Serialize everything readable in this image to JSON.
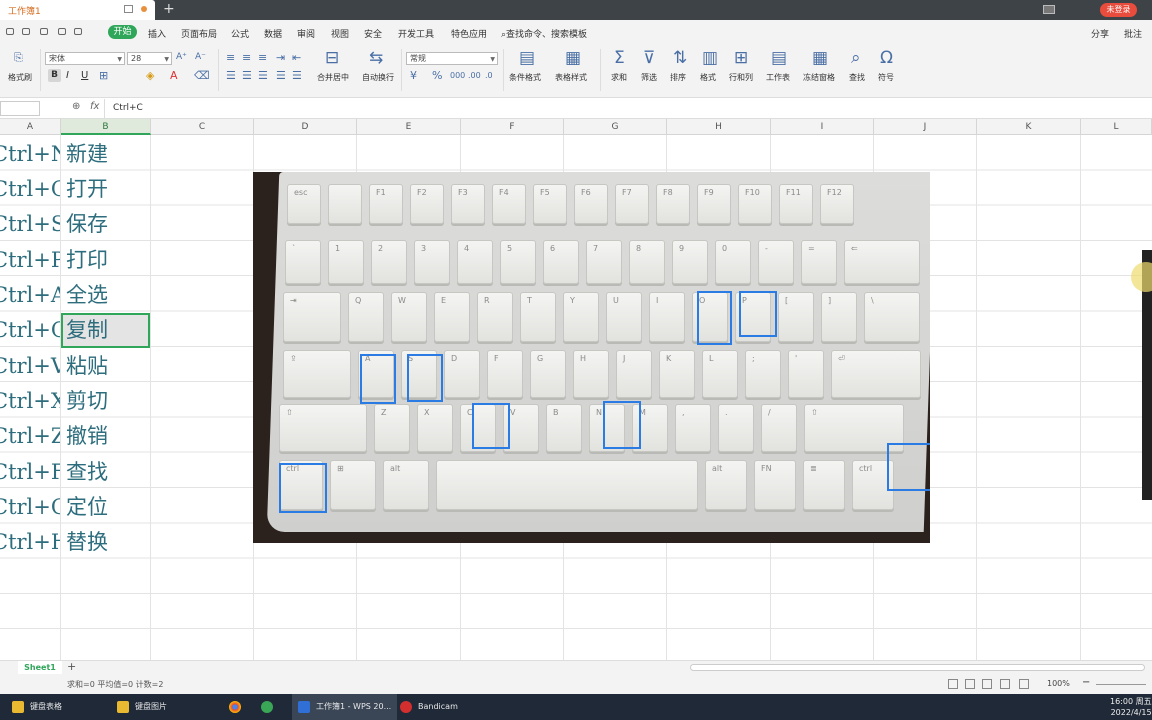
{
  "window": {
    "doc_tab_title": "工作簿1",
    "login_label": "未登录"
  },
  "menu": {
    "items": [
      "开始",
      "插入",
      "页面布局",
      "公式",
      "数据",
      "审阅",
      "视图",
      "安全",
      "开发工具",
      "特色应用"
    ],
    "search_placeholder": "查找命令、搜索模板",
    "share_label": "分享",
    "comment_label": "批注"
  },
  "ribbon": {
    "paste_format_label": "格式刷",
    "font_name": "宋体",
    "font_size": "28",
    "number_format": "常规",
    "merge_label": "合并居中",
    "wrap_label": "自动换行",
    "cond_format_label": "条件格式",
    "table_style_label": "表格样式",
    "sum_label": "求和",
    "filter_label": "筛选",
    "sort_label": "排序",
    "format_label": "格式",
    "rowcol_label": "行和列",
    "worksheet_label": "工作表",
    "freeze_label": "冻结窗格",
    "find_label": "查找",
    "symbol_label": "符号"
  },
  "formula_bar": {
    "fx_label": "fx",
    "formula": "Ctrl+C"
  },
  "columns": [
    "A",
    "B",
    "C",
    "D",
    "E",
    "F",
    "G",
    "H",
    "I",
    "J",
    "K",
    "L"
  ],
  "sheet_rows": [
    {
      "a": "Ctrl+N",
      "b": "新建"
    },
    {
      "a": "Ctrl+O",
      "b": "打开"
    },
    {
      "a": "Ctrl+S",
      "b": "保存"
    },
    {
      "a": "Ctrl+P",
      "b": "打印"
    },
    {
      "a": "Ctrl+A",
      "b": "全选"
    },
    {
      "a": "Ctrl+C",
      "b": "复制"
    },
    {
      "a": "Ctrl+V",
      "b": "粘贴"
    },
    {
      "a": "Ctrl+X",
      "b": "剪切"
    },
    {
      "a": "Ctrl+Z",
      "b": "撤销"
    },
    {
      "a": "Ctrl+F",
      "b": "查找"
    },
    {
      "a": "Ctrl+G",
      "b": "定位"
    },
    {
      "a": "Ctrl+H",
      "b": "替换"
    }
  ],
  "keyboard": {
    "highlighted_keys": [
      "O",
      "P",
      "A",
      "S",
      "C",
      "N",
      "ctrl",
      "ctrl"
    ],
    "highlight_color": "#2a7be4"
  },
  "sheet_tabs": {
    "active": "Sheet1"
  },
  "status": {
    "summary": "求和=0  平均值=0  计数=2",
    "zoom": "100%"
  },
  "taskbar": {
    "items": [
      "键盘表格",
      "键盘图片",
      "工作簿1 - WPS 20...",
      "Bandicam"
    ],
    "time": "16:00 周五",
    "date": "2022/4/15"
  },
  "colors": {
    "accent": "#30a65a",
    "cell_text": "#2d6d7d"
  }
}
